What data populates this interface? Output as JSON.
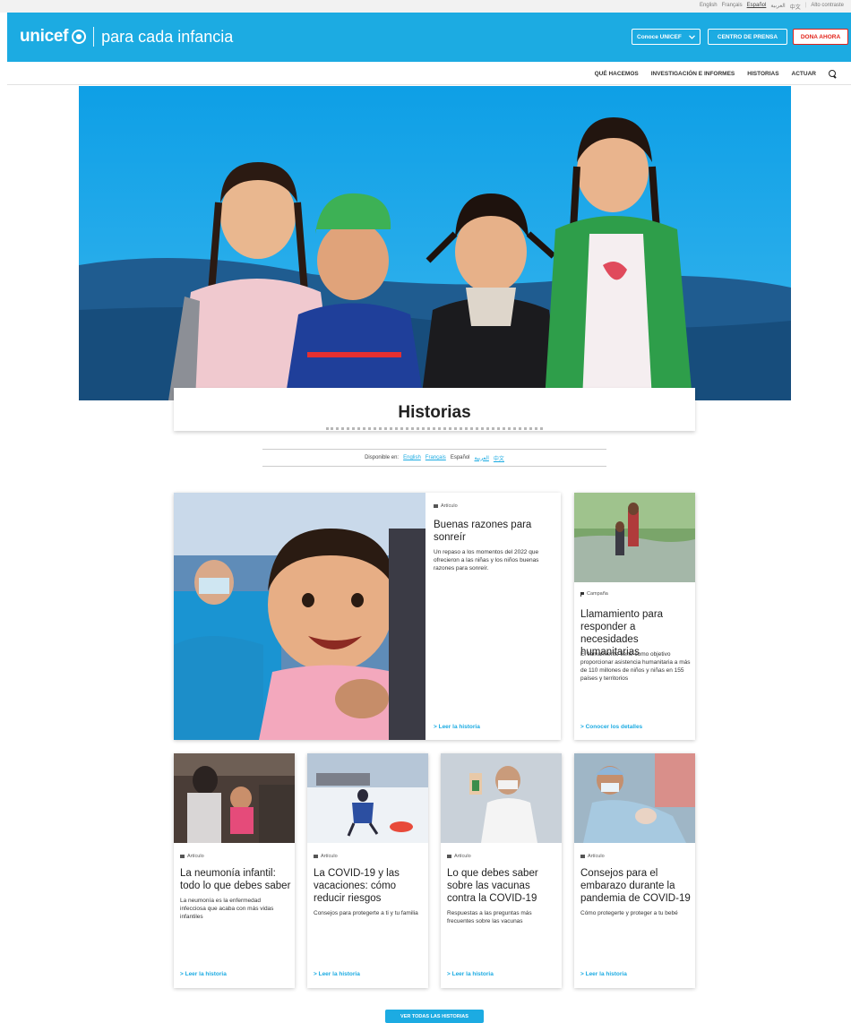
{
  "utility_bar": {
    "languages": [
      "English",
      "Français",
      "Español",
      "العربية",
      "中文"
    ],
    "active_language": "Español",
    "contrast": "Alto contraste"
  },
  "header": {
    "logo_word": "unicef",
    "tagline": "para cada infancia",
    "conoce_label": "Conoce UNICEF",
    "prensa_label": "CENTRO DE PRENSA",
    "dona_label": "DONA AHORA",
    "brand_color": "#1cabe2",
    "donate_color": "#e2231a"
  },
  "nav": {
    "items": [
      "QUÉ HACEMOS",
      "INVESTIGACIÓN E INFORMES",
      "HISTORIAS",
      "ACTUAR"
    ],
    "search_icon": "search-icon"
  },
  "hero": {
    "title": "Historias",
    "image": "four smiling children in front of blue sky"
  },
  "available": {
    "label": "Disponible en:",
    "languages": [
      "English",
      "Français",
      "Español",
      "العربية",
      "中文"
    ]
  },
  "featured": {
    "type": "Artículo",
    "title": "Buenas razones para sonreír",
    "description": "Un repaso a los momentos del 2022 que ofrecieron a las niñas y los niños buenas razones para sonreír.",
    "link": "> Leer la historia"
  },
  "campaign": {
    "type": "Campaña",
    "title": "Llamamiento para responder a necesidades humanitarias",
    "description": "El llamamiento tiene como objetivo proporcionar asistencia humanitaria a más de 110 millones de niños y niñas en 155 países y territorios",
    "link": "> Conocer los detalles"
  },
  "cards": [
    {
      "type": "Artículo",
      "title": "La neumonía infantil: todo lo que debes saber",
      "description": "La neumonía es la enfermedad infecciosa que acaba con más vidas infantiles",
      "link": "> Leer la historia"
    },
    {
      "type": "Artículo",
      "title": "La COVID-19 y las vacaciones: cómo reducir riesgos",
      "description": "Consejos para protegerte a ti y tu familia",
      "link": "> Leer la historia"
    },
    {
      "type": "Artículo",
      "title": "Lo que debes saber sobre las vacunas contra la COVID-19",
      "description": "Respuestas a las preguntas más frecuentes sobre las vacunas",
      "link": "> Leer la historia"
    },
    {
      "type": "Artículo",
      "title": "Consejos para el embarazo durante la pandemia de COVID-19",
      "description": "Cómo protegerte y proteger a tu bebé",
      "link": "> Leer la historia"
    }
  ],
  "see_all_label": "VER TODAS LAS HISTORIAS"
}
